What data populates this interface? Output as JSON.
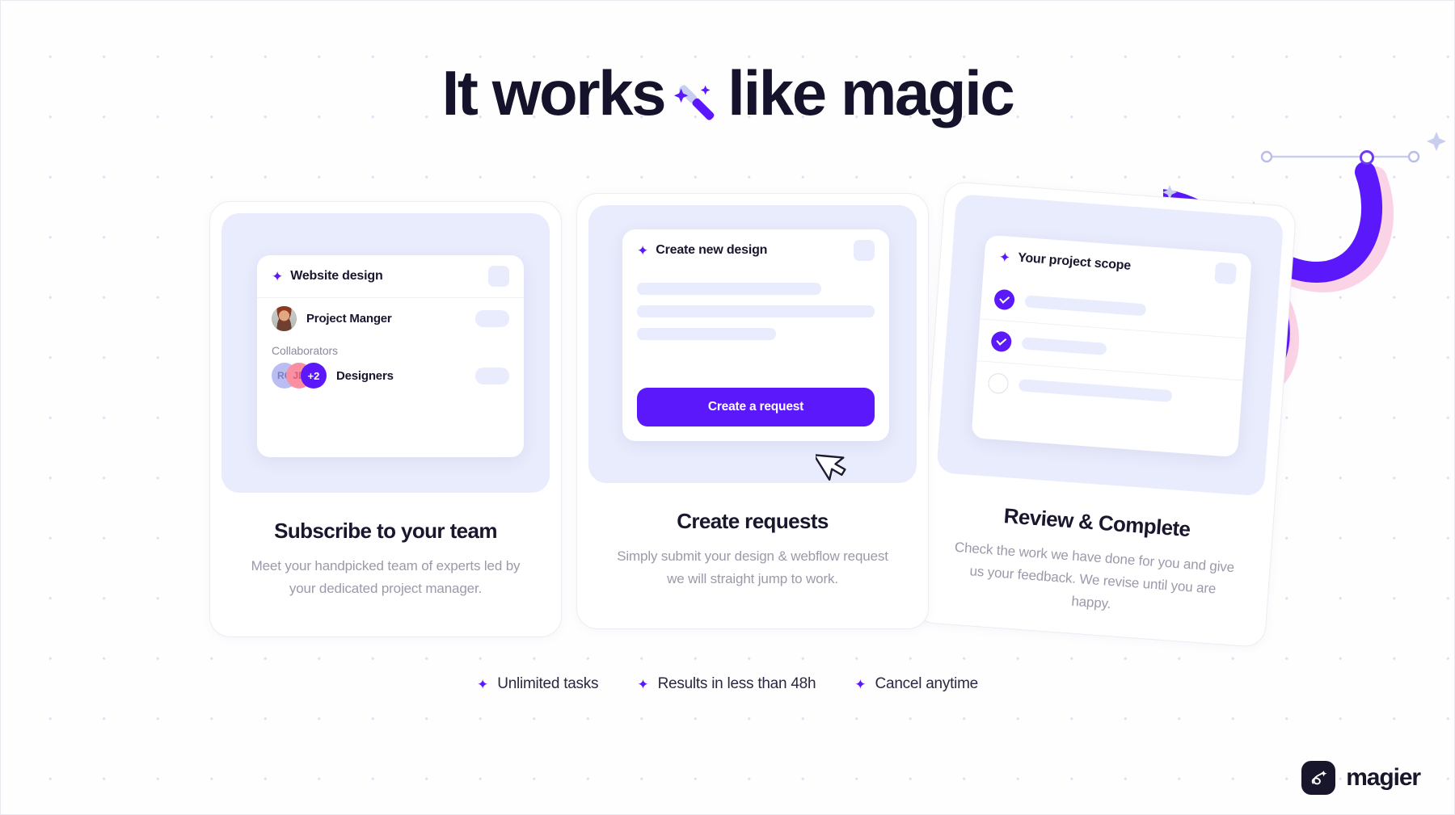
{
  "headline": {
    "before": "It works",
    "icon": "magic-wand-emoji",
    "after": "like magic"
  },
  "colors": {
    "accent_purple": "#5B18FA",
    "panel_lavender": "#E9ECFD",
    "pink_outline": "#FBD3E6",
    "text_dark": "#18172E",
    "text_muted": "#9A9AAB",
    "dot_grid": "#DCDCF5"
  },
  "cards": [
    {
      "mock": {
        "header": "Website design",
        "header_icon": "sparkle-icon",
        "person": {
          "name": "Project Manger",
          "avatar": "user-photo-avatar"
        },
        "collaborators_label": "Collaborators",
        "avatars": [
          {
            "initials": "RO",
            "color": "#B9BDF2"
          },
          {
            "initials": "JD",
            "color": "#FB8FA2"
          },
          {
            "initials": "+2",
            "color": "#5B18FA"
          }
        ],
        "collaborators_role": "Designers"
      },
      "title": "Subscribe to your team",
      "description": "Meet your handpicked team of experts led by your dedicated project manager."
    },
    {
      "mock": {
        "header": "Create new design",
        "header_icon": "sparkle-icon",
        "skeleton_lines": 3,
        "cta_label": "Create a request",
        "cursor": "mouse-pointer"
      },
      "title": "Create requests",
      "description": "Simply submit your design & webflow request we will straight jump to work."
    },
    {
      "mock": {
        "header": "Your project scope",
        "header_icon": "sparkle-icon",
        "checklist": [
          {
            "state": "checked"
          },
          {
            "state": "checked"
          },
          {
            "state": "unchecked"
          }
        ]
      },
      "title": "Review & Complete",
      "description": "Check the work we have done for you and give us your feedback. We revise until you are happy."
    }
  ],
  "features": [
    {
      "icon": "sparkle-icon",
      "label": "Unlimited tasks"
    },
    {
      "icon": "sparkle-icon",
      "label": "Results in less than 48h"
    },
    {
      "icon": "sparkle-icon",
      "label": "Cancel anytime"
    }
  ],
  "logo": {
    "mark": "magier-wand-mark",
    "name": "magier"
  }
}
